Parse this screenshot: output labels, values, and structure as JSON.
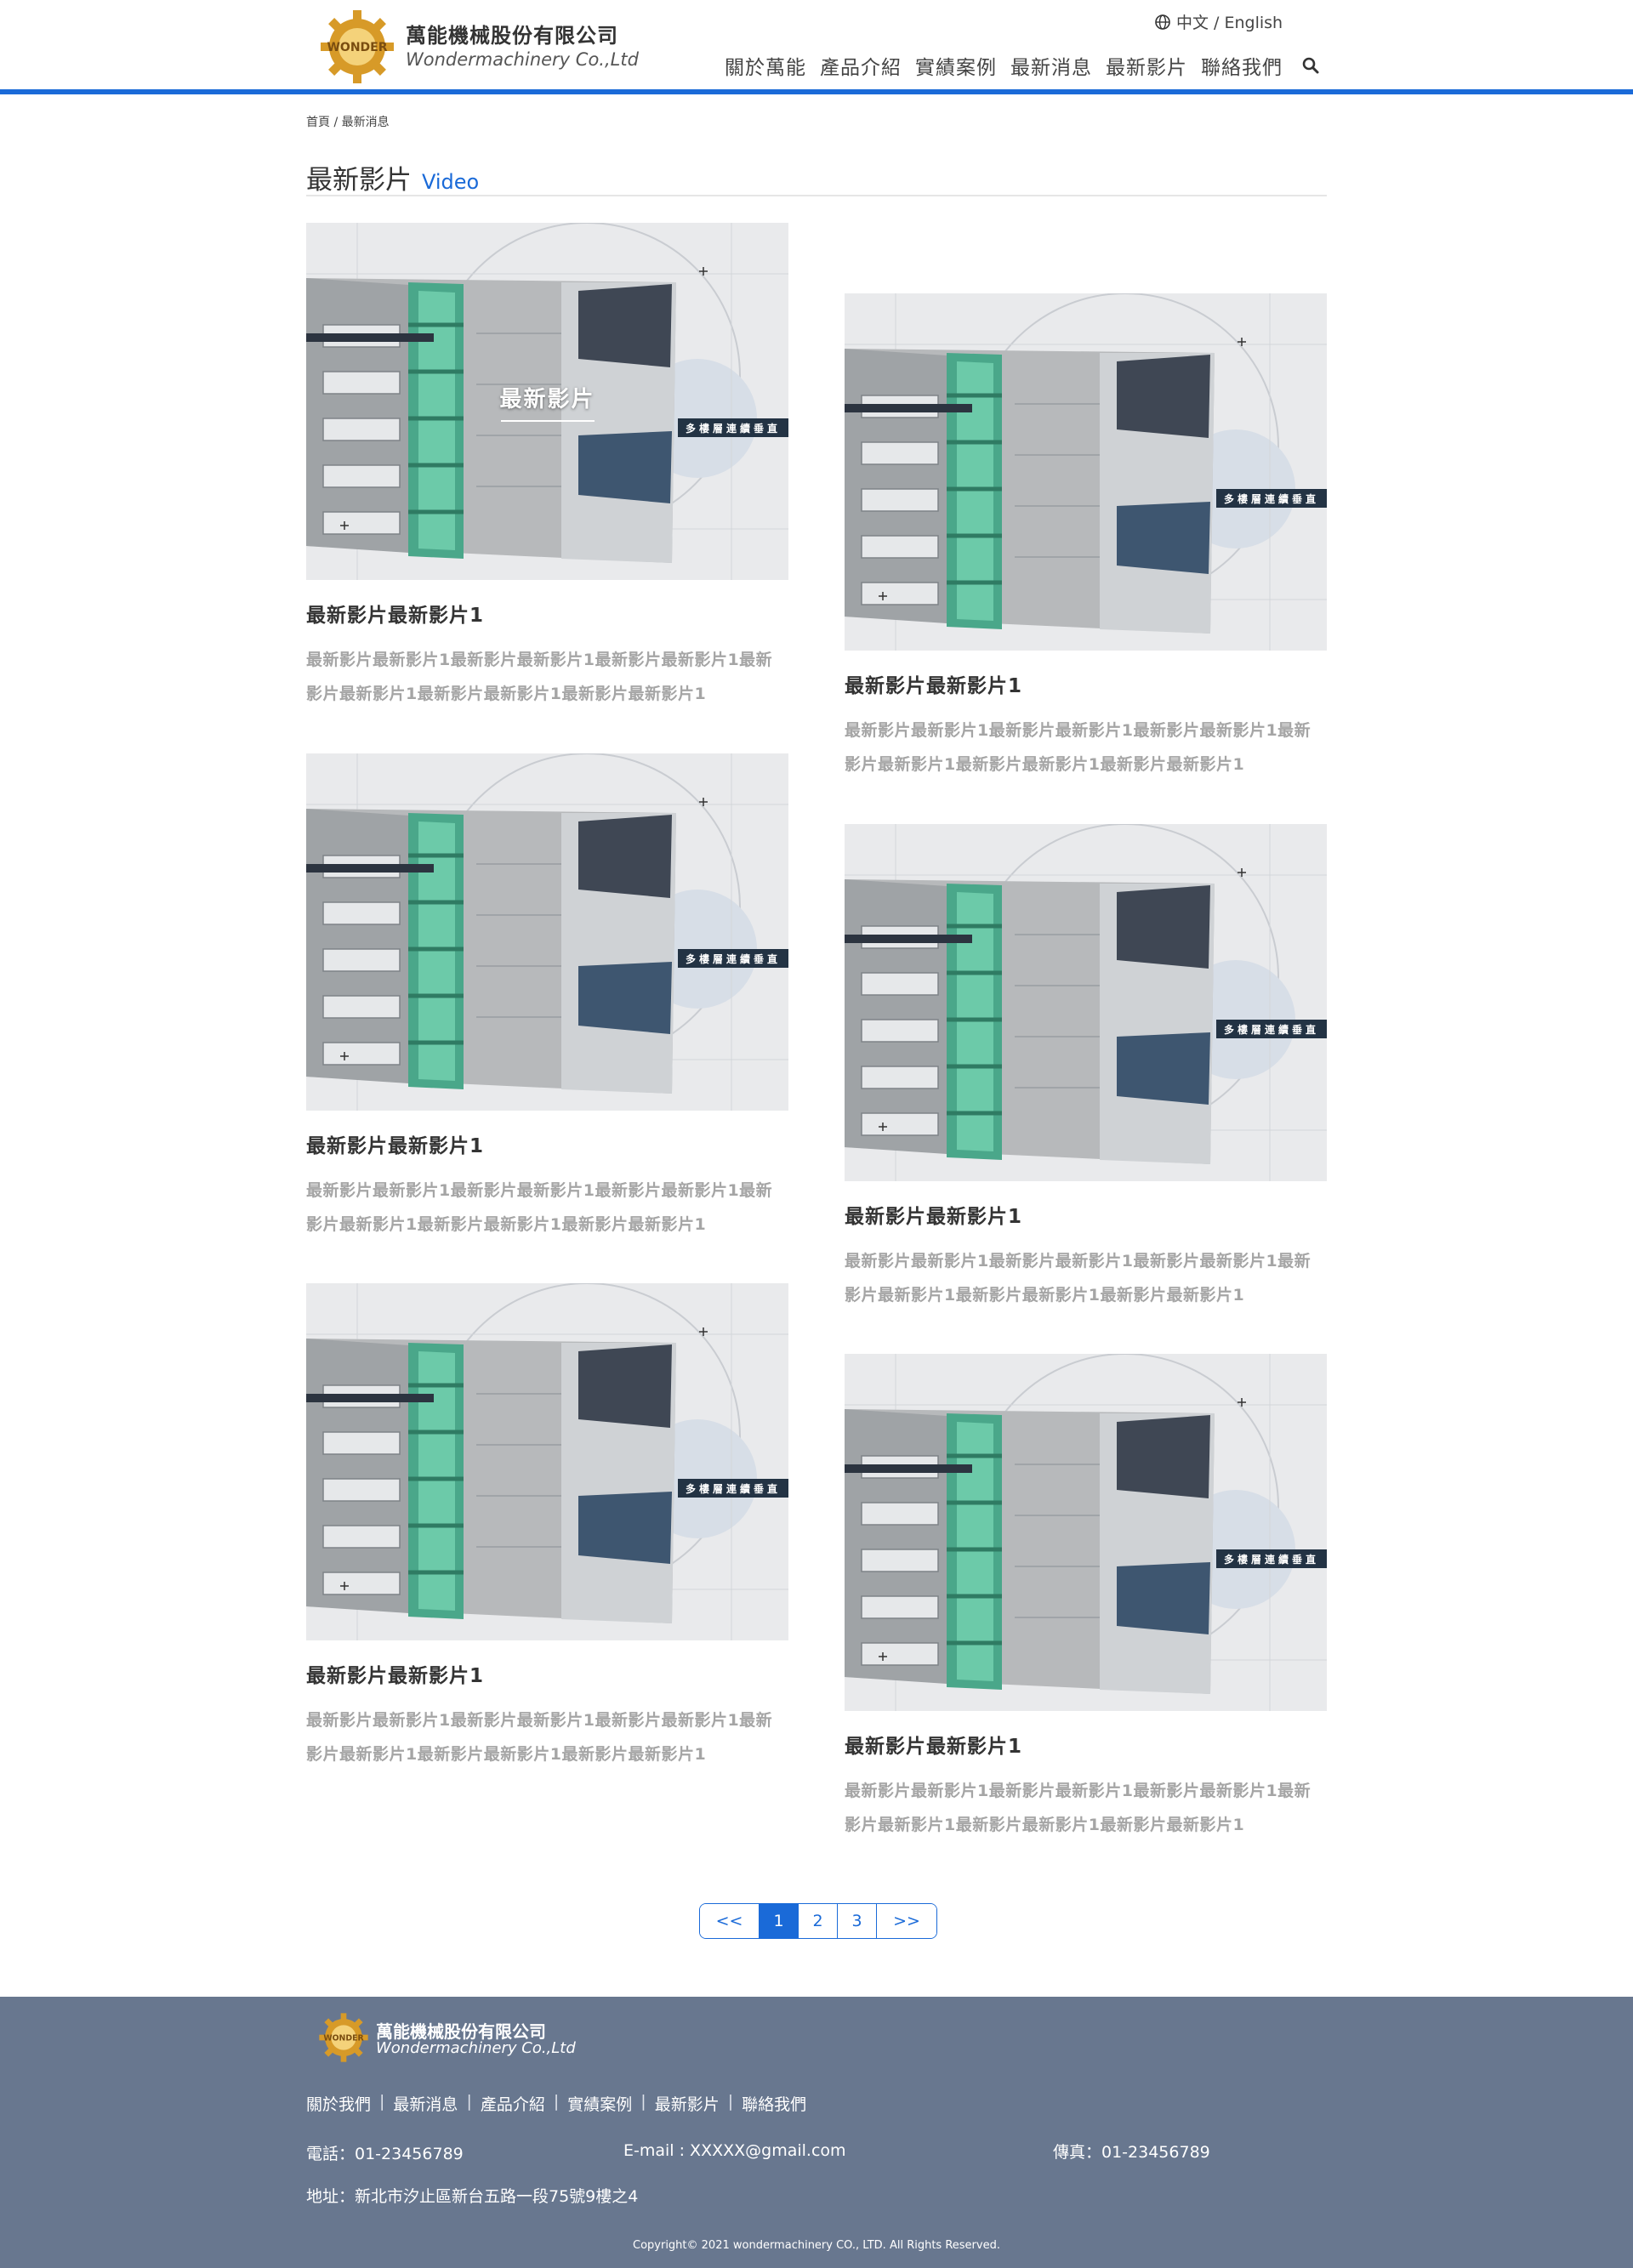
{
  "header": {
    "brand_cn": "萬能機械股份有限公司",
    "brand_en": "Wondermachinery Co.,Ltd",
    "logo_text": "WONDER",
    "lang": "中文 / English",
    "nav": [
      "關於萬能",
      "產品介紹",
      "實績案例",
      "最新消息",
      "最新影片",
      "聯絡我們"
    ],
    "accent": "#1a6ad8"
  },
  "breadcrumb": "首頁 / 最新消息",
  "page_title": {
    "cn": "最新影片",
    "en": "Video"
  },
  "thumb_badge": "多樓層連續垂直",
  "hover_caption": "最新影片",
  "videos": [
    {
      "title": "最新影片最新影片1",
      "desc": "最新影片最新影片1最新影片最新影片1最新影片最新影片1最新影片最新影片1最新影片最新影片1最新影片最新影片1"
    },
    {
      "title": "最新影片最新影片1",
      "desc": "最新影片最新影片1最新影片最新影片1最新影片最新影片1最新影片最新影片1最新影片最新影片1最新影片最新影片1"
    },
    {
      "title": "最新影片最新影片1",
      "desc": "最新影片最新影片1最新影片最新影片1最新影片最新影片1最新影片最新影片1最新影片最新影片1最新影片最新影片1"
    },
    {
      "title": "最新影片最新影片1",
      "desc": "最新影片最新影片1最新影片最新影片1最新影片最新影片1最新影片最新影片1最新影片最新影片1最新影片最新影片1"
    },
    {
      "title": "最新影片最新影片1",
      "desc": "最新影片最新影片1最新影片最新影片1最新影片最新影片1最新影片最新影片1最新影片最新影片1最新影片最新影片1"
    },
    {
      "title": "最新影片最新影片1",
      "desc": "最新影片最新影片1最新影片最新影片1最新影片最新影片1最新影片最新影片1最新影片最新影片1最新影片最新影片1"
    }
  ],
  "pagination": {
    "prev": "<<",
    "pages": [
      "1",
      "2",
      "3"
    ],
    "current": "1",
    "next": ">>"
  },
  "footer": {
    "brand_cn": "萬能機械股份有限公司",
    "brand_en": "Wondermachinery Co.,Ltd",
    "links": [
      "關於我們",
      "最新消息",
      "產品介紹",
      "實績案例",
      "最新影片",
      "聯絡我們"
    ],
    "separator": "|",
    "phone": "電話：01-23456789",
    "email": "E-mail :   XXXXX@gmail.com",
    "fax": "傳真：01-23456789",
    "address": "地址：新北市汐止區新台五路一段75號9樓之4",
    "copyright": "Copyright© 2021 wondermachinery  CO., LTD. All Rights Reserved.",
    "bg_color": "#68778f"
  }
}
